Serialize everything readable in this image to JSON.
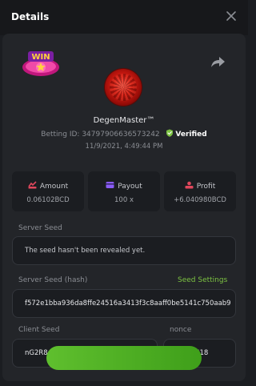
{
  "header": {
    "title": "Details"
  },
  "bet": {
    "username": "DegenMaster™",
    "betting_id_label": "Betting ID:",
    "betting_id": "34797906636573242",
    "verified_label": "Verified",
    "datetime": "11/9/2021, 4:49:44 PM"
  },
  "stats": {
    "amount": {
      "label": "Amount",
      "value": "0.06102BCD"
    },
    "payout": {
      "label": "Payout",
      "value": "100 x"
    },
    "profit": {
      "label": "Profit",
      "value": "+6.040980BCD"
    }
  },
  "seeds": {
    "server_seed_label": "Server Seed",
    "server_seed_value": "The seed hasn't been revealed yet.",
    "server_hash_label": "Server Seed (hash)",
    "seed_settings_link": "Seed Settings",
    "server_hash_value": "f572e1bba936da8ffe24516a3413f3c8aaff0be5141c750aab9",
    "client_seed_label": "Client Seed",
    "client_seed_value": "nG2R8dir4r",
    "nonce_label": "nonce",
    "nonce_value": "2618"
  },
  "colors": {
    "accent_green": "#7cc242",
    "amount_icon": "#e0475c",
    "payout_icon": "#8a5cf6",
    "profit_icon": "#e0475c"
  },
  "icons": {
    "close": "close-icon",
    "share": "share-icon",
    "win": "win-badge-icon",
    "verified": "shield-check-icon"
  }
}
